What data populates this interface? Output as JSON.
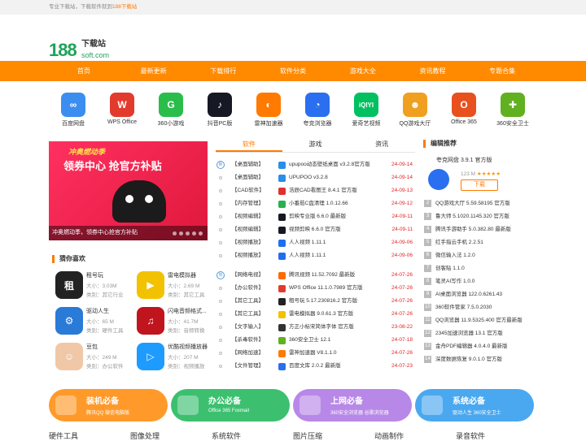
{
  "topbar": {
    "text": "专业下载站，下载软件就到",
    "hl": "188下载站"
  },
  "logo": {
    "num": "188",
    "cn": "下载站",
    "en": "soft.com"
  },
  "nav": [
    "首页",
    "最新更新",
    "下载排行",
    "软件分类",
    "游戏大全",
    "资讯教程",
    "专题合集"
  ],
  "apps": [
    {
      "label": "百度网盘",
      "icon": "baidu-netdisk-icon",
      "color": "#3b8ef0",
      "g": "∞"
    },
    {
      "label": "WPS Office",
      "icon": "wps-icon",
      "color": "#e23b2e",
      "g": "W"
    },
    {
      "label": "360小游戏",
      "icon": "game360-icon",
      "color": "#2bbd4a",
      "g": "G"
    },
    {
      "label": "抖音PC版",
      "icon": "douyin-icon",
      "color": "#161823",
      "g": "♪"
    },
    {
      "label": "雷神加速器",
      "icon": "leishen-icon",
      "color": "#ff7a00",
      "g": "◐"
    },
    {
      "label": "夸克浏览器",
      "icon": "quark-icon",
      "color": "#2a6ff0",
      "g": "◔"
    },
    {
      "label": "爱奇艺视频",
      "icon": "iqiyi-icon",
      "color": "#00c060",
      "g": "iQIYI"
    },
    {
      "label": "QQ游戏大厅",
      "icon": "qqgame-icon",
      "color": "#f0a020",
      "g": "☻"
    },
    {
      "label": "Office 365",
      "icon": "office-icon",
      "color": "#e8501e",
      "g": "O"
    },
    {
      "label": "360安全卫士",
      "icon": "safe360-icon",
      "color": "#60b020",
      "g": "✚"
    }
  ],
  "banner": {
    "slogan": "冲奥燃动季",
    "headline": "领券中心 抢官方补贴",
    "caption": "冲奥燃动季，领券中心抢官方补贴"
  },
  "guess": {
    "title": "猜你喜欢",
    "size_label": "大小：",
    "cat_label": "类别：",
    "items": [
      {
        "name": "租号玩",
        "size": "3.03M",
        "cat": "其它行业",
        "color": "#222",
        "g": "租"
      },
      {
        "name": "雷电模拟器",
        "size": "2.69 M",
        "cat": "其它工具",
        "color": "#f2c200",
        "g": "▶"
      },
      {
        "name": "驱动人生",
        "size": "65 M",
        "cat": "硬件工具",
        "color": "#2a7ad8",
        "g": "⚙"
      },
      {
        "name": "闪电音频格式...",
        "size": "41.7M",
        "cat": "音频转换",
        "color": "#c0141e",
        "g": "♫"
      },
      {
        "name": "豆包",
        "size": "249 M",
        "cat": "办公软件",
        "color": "#f0c8a8",
        "g": "☺"
      },
      {
        "name": "优酷视频播放器",
        "size": "207 M",
        "cat": "视频播放",
        "color": "#1e9bff",
        "g": "▷"
      }
    ]
  },
  "tabs": [
    "软件",
    "游戏",
    "资讯"
  ],
  "listA": [
    {
      "cat": "【桌面辅助】",
      "title": "upupoo动态壁纸桌面 v3.2.8官方版",
      "date": "24-09-14",
      "color": "#2a8ee8"
    },
    {
      "cat": "【桌面辅助】",
      "title": "UPUPOO v3.2.8",
      "date": "24-09-14",
      "color": "#2a8ee8"
    },
    {
      "cat": "【CAD软件】",
      "title": "浩辰CAD看图王 8.4.1 官方版",
      "date": "24-09-13",
      "color": "#e03030"
    },
    {
      "cat": "【内存管理】",
      "title": "小番茄C盘清理 1.0.12.66",
      "date": "24-09-12",
      "color": "#2ab050"
    },
    {
      "cat": "【视频编辑】",
      "title": "剪映专业版 6.6.0 最新版",
      "date": "24-09-11",
      "color": "#161823"
    },
    {
      "cat": "【视频编辑】",
      "title": "视频剪映 6.6.0 官方版",
      "date": "24-09-11",
      "color": "#161823"
    },
    {
      "cat": "【视频播放】",
      "title": "人人视频 1.11.1",
      "date": "24-09-06",
      "color": "#1e6ff0"
    },
    {
      "cat": "【视频播放】",
      "title": "人人视频 1.11.1",
      "date": "24-09-06",
      "color": "#1e6ff0"
    }
  ],
  "listB": [
    {
      "cat": "【网络电视】",
      "title": "腾讯视频 11.52.7092 最新版",
      "date": "24-07-26",
      "color": "#ff6a00"
    },
    {
      "cat": "【办公软件】",
      "title": "WPS Office 11.1.0.7989 官方版",
      "date": "24-07-26",
      "color": "#e23b2e"
    },
    {
      "cat": "【其它工具】",
      "title": "租号玩 5.17.230816.2 官方版",
      "date": "24-07-26",
      "color": "#222"
    },
    {
      "cat": "【其它工具】",
      "title": "雷电模拟器 9.0.61.3 官方版",
      "date": "24-07-26",
      "color": "#f2c200"
    },
    {
      "cat": "【文字输入】",
      "title": "方正小标宋简体字体 官方版",
      "date": "23-08-22",
      "color": "#333"
    },
    {
      "cat": "【杀毒软件】",
      "title": "360安全卫士 12.1",
      "date": "24-07-18",
      "color": "#60b020"
    },
    {
      "cat": "【网络加速】",
      "title": "雷神加速器 V8.1.1.0",
      "date": "24-07-26",
      "color": "#ff7a00"
    },
    {
      "cat": "【文件管理】",
      "title": "百度文库 2.0.2 最新版",
      "date": "24-07-23",
      "color": "#2a6ff0"
    }
  ],
  "listB_badge": "热",
  "listA_badge": "新",
  "editor": {
    "title": "编辑推荐",
    "feat_title": "夸克网盘 3.9.1 官方版",
    "feat_size": "123 M",
    "feat_stars": "★★★★★",
    "download": "下载",
    "items": [
      "QQ游戏大厅 5.59.58195 官方版",
      "鲁大师 5.1020.1145.320 官方版",
      "腾讯手游助手 5.0.382.80 最新版",
      "红手指云手机 2.2.51",
      "微信输入法 1.2.0",
      "创客贴 1.1.0",
      "笔灵AI写作 1.0.0",
      "AI桌面浏览器 122.0.6261.43",
      "360软件管家 7.5.0.2030",
      "QQ浏览器 11.9.5325.400 官方最新版",
      "2345加速浏览器 13.1 官方版",
      "金舟PDF编辑器 4.0.4.0 最新版",
      "深度数据恢复 9.0.1.0 官方版"
    ],
    "nums": [
      "2",
      "3",
      "4",
      "5",
      "6",
      "7",
      "8",
      "9",
      "10",
      "11",
      "12",
      "13",
      "14"
    ]
  },
  "cats": [
    {
      "t1": "装机必备",
      "t2": "腾讯QQ    微信电脑版",
      "color": "#ff9a2a",
      "icon": "install-icon"
    },
    {
      "t1": "办公必备",
      "t2": "Office 365    Foxmail",
      "color": "#3cc070",
      "icon": "office-bag-icon"
    },
    {
      "t1": "上网必备",
      "t2": "360安全浏览器    谷歌浏览器",
      "color": "#b888e8",
      "icon": "ie-icon"
    },
    {
      "t1": "系统必备",
      "t2": "驱动人生    360安全卫士",
      "color": "#4aa8f0",
      "icon": "system-icon"
    }
  ],
  "foot": [
    "硬件工具",
    "图像处理",
    "系统软件",
    "图片压缩",
    "动画制作",
    "录音软件"
  ]
}
